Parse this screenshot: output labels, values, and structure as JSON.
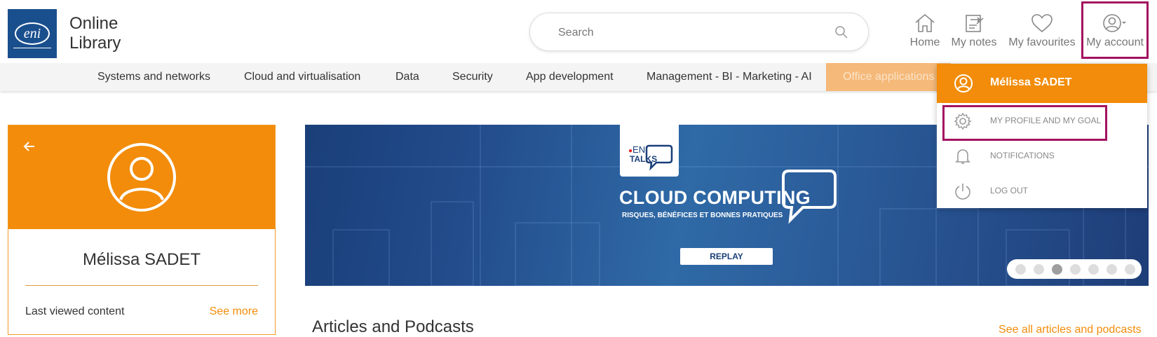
{
  "brand": {
    "line1": "Online",
    "line2": "Library",
    "logo_text": "eni",
    "color": "#1a4f8e"
  },
  "search": {
    "placeholder": "Search"
  },
  "nav": {
    "home": "Home",
    "notes": "My notes",
    "favourites": "My favourites",
    "account": "My account"
  },
  "categories": [
    "Systems and networks",
    "Cloud and virtualisation",
    "Data",
    "Security",
    "App development",
    "Management - BI - Marketing - AI",
    "Office applications"
  ],
  "profile": {
    "name": "Mélissa SADET",
    "last_viewed": "Last viewed content",
    "see_more": "See more"
  },
  "banner": {
    "eni": "ENI",
    "talks": "TALKS",
    "title": "CLOUD COMPUTING",
    "subtitle": "RISQUES, BÉNÉFICES ET BONNES PRATIQUES",
    "button": "REPLAY",
    "dot_count": 7,
    "active_dot": 3
  },
  "articles": {
    "title": "Articles and Podcasts",
    "see_all": "See all articles and podcasts"
  },
  "dropdown": {
    "user": "Mélissa SADET",
    "items": [
      "MY PROFILE AND MY GOAL",
      "NOTIFICATIONS",
      "LOG OUT"
    ]
  },
  "colors": {
    "accent": "#f28c0a",
    "highlight": "#a3125f"
  }
}
